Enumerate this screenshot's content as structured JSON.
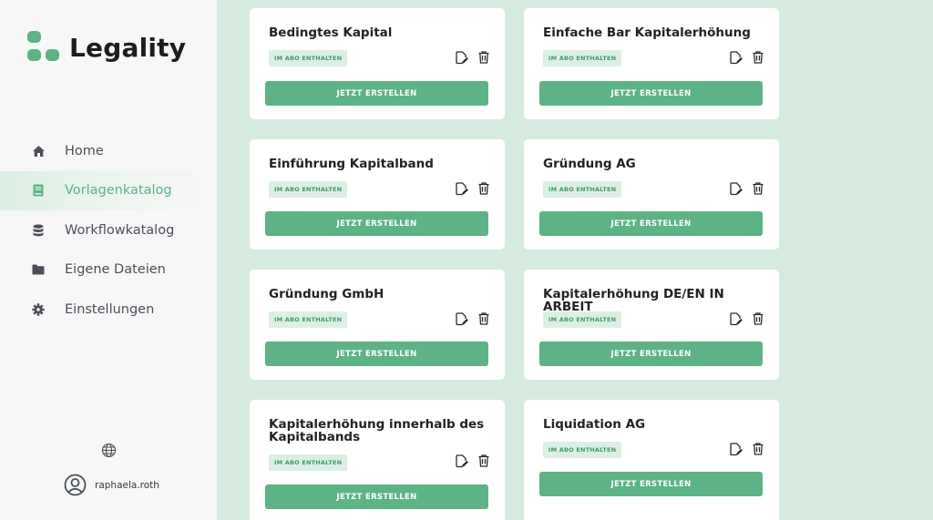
{
  "brand": {
    "name": "Legality",
    "accent": "#5db385"
  },
  "nav": [
    {
      "label": "Home",
      "icon": "home-icon",
      "active": false
    },
    {
      "label": "Vorlagenkatalog",
      "icon": "book-icon",
      "active": true
    },
    {
      "label": "Workflowkatalog",
      "icon": "database-icon",
      "active": false
    },
    {
      "label": "Eigene Dateien",
      "icon": "folder-icon",
      "active": false
    },
    {
      "label": "Einstellungen",
      "icon": "gear-icon",
      "active": false
    }
  ],
  "footer": {
    "language_icon": "globe-icon",
    "username": "raphaela.roth"
  },
  "templates": [
    {
      "title": "Bedingtes Kapital",
      "badge": "IM ABO ENTHALTEN",
      "button": "JETZT ERSTELLEN"
    },
    {
      "title": "Einfache Bar Kapitalerhöhung",
      "badge": "IM ABO ENTHALTEN",
      "button": "JETZT ERSTELLEN"
    },
    {
      "title": "Einführung Kapitalband",
      "badge": "IM ABO ENTHALTEN",
      "button": "JETZT ERSTELLEN"
    },
    {
      "title": "Gründung AG",
      "badge": "IM ABO ENTHALTEN",
      "button": "JETZT ERSTELLEN"
    },
    {
      "title": "Gründung GmbH",
      "badge": "IM ABO ENTHALTEN",
      "button": "JETZT ERSTELLEN"
    },
    {
      "title": "Kapitalerhöhung DE/EN IN ARBEIT",
      "badge": "IM ABO ENTHALTEN",
      "button": "JETZT ERSTELLEN"
    },
    {
      "title": "Kapitalerhöhung innerhalb des Kapitalbands",
      "badge": "IM ABO ENTHALTEN",
      "button": "JETZT ERSTELLEN"
    },
    {
      "title": "Liquidation AG",
      "badge": "IM ABO ENTHALTEN",
      "button": "JETZT ERSTELLEN"
    }
  ]
}
